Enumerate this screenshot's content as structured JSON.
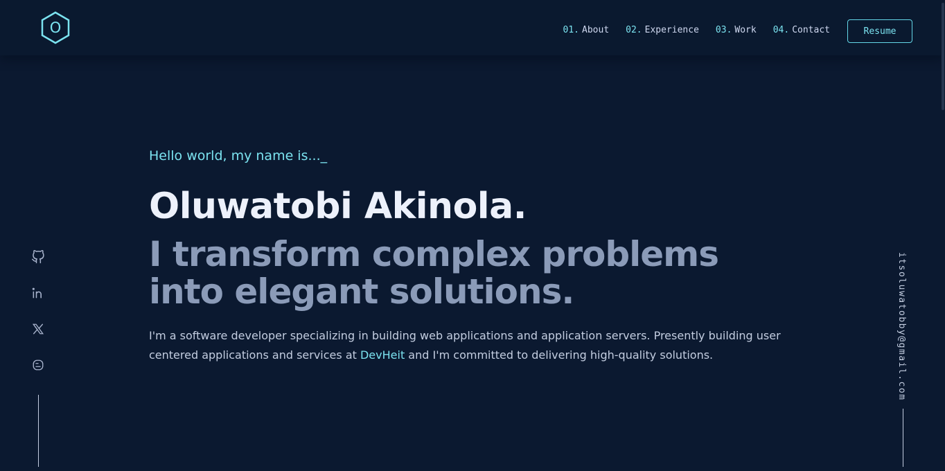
{
  "logo": {
    "letter": "O",
    "icon": "hexagon-logo-icon"
  },
  "nav": [
    {
      "num": "01.",
      "label": "About"
    },
    {
      "num": "02.",
      "label": "Experience"
    },
    {
      "num": "03.",
      "label": "Work"
    },
    {
      "num": "04.",
      "label": "Contact"
    }
  ],
  "resume_label": "Resume",
  "hero": {
    "greeting": "Hello world, my name is..._",
    "name": "Oluwatobi Akinola.",
    "tagline_line1": "I transform complex problems",
    "tagline_line2": "into elegant solutions.",
    "intro_part1": "I'm a software developer specializing in building web applications and application servers. Presently building user centered applications and services at ",
    "company": "DevHeit",
    "intro_part2": " and I'm committed to delivering high-quality solutions."
  },
  "socials": [
    "github-icon",
    "linkedin-icon",
    "x-icon",
    "blog-icon"
  ],
  "email": "itsoluwatobby@gmail.com",
  "colors": {
    "background": "#0b1930",
    "accent": "#7be3f0",
    "heading": "#edf1fb",
    "muted": "#8b9bb8",
    "body_text": "#c3cde0"
  }
}
